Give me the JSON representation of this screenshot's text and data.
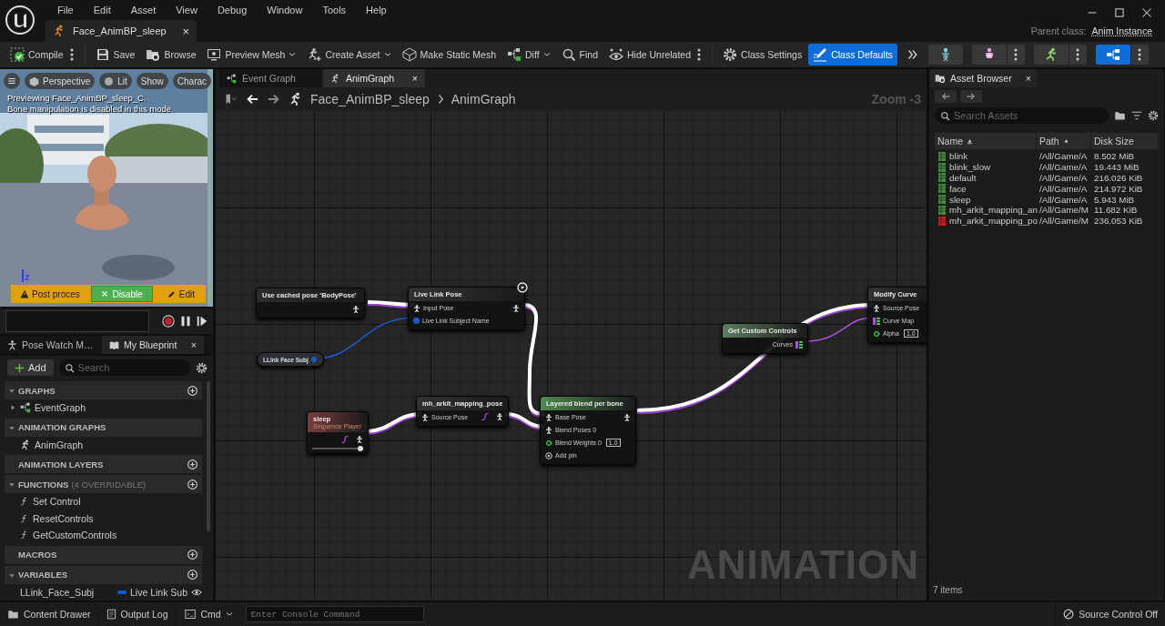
{
  "menu": [
    "File",
    "Edit",
    "Asset",
    "View",
    "Debug",
    "Window",
    "Tools",
    "Help"
  ],
  "document_tab": {
    "title": "Face_AnimBP_sleep",
    "close": "×"
  },
  "parent_class": {
    "label": "Parent class:",
    "value": "Anim Instance"
  },
  "toolbar": [
    {
      "label": "Compile",
      "more": true,
      "selected": false
    },
    {
      "label": "Save",
      "selected": false
    },
    {
      "label": "Browse",
      "selected": false
    },
    {
      "label": "Preview Mesh",
      "dropdown": true,
      "selected": false
    },
    {
      "label": "Create Asset",
      "dropdown": true,
      "selected": false
    },
    {
      "label": "Make Static Mesh",
      "selected": false
    },
    {
      "label": "Diff",
      "dropdown": true,
      "selected": false
    },
    {
      "label": "Find",
      "selected": false
    },
    {
      "label": "Hide Unrelated",
      "more": true,
      "selected": false
    },
    {
      "label": "Class Settings",
      "selected": false
    },
    {
      "label": "Class Defaults",
      "selected": true
    }
  ],
  "modes": [
    {
      "selected": false,
      "more": false
    },
    {
      "selected": false,
      "more": true
    },
    {
      "selected": false,
      "more": true
    },
    {
      "selected": true,
      "more": true
    }
  ],
  "viewport": {
    "buttons": [
      "Perspective",
      "Lit",
      "Show",
      "Charac"
    ],
    "message": [
      "Previewing Face_AnimBP_sleep_C.",
      "Bone manipulation is disabled in this mode."
    ],
    "axis": "Z",
    "notice": {
      "text": "Post proces",
      "disable": "Disable",
      "edit": "Edit"
    }
  },
  "left_tabs": [
    {
      "label": "Pose Watch M…",
      "selected": false
    },
    {
      "label": "My Blueprint",
      "selected": true,
      "close": "×"
    }
  ],
  "my_blueprint": {
    "add": "Add",
    "search": {
      "placeholder": "Search"
    },
    "sections": [
      {
        "title": "GRAPHS",
        "expanded": true,
        "add": true,
        "items": [
          {
            "kind": "graph",
            "label": "EventGraph",
            "expanded": false
          }
        ]
      },
      {
        "title": "ANIMATION GRAPHS",
        "expanded": true,
        "add": false,
        "items": [
          {
            "kind": "anim_graph",
            "label": "AnimGraph"
          }
        ]
      },
      {
        "title": "ANIMATION LAYERS",
        "add": true
      },
      {
        "title": "FUNCTIONS",
        "note": "(4 OVERRIDABLE)",
        "expanded": true,
        "add": true,
        "items": [
          {
            "kind": "function",
            "label": "Set Control"
          },
          {
            "kind": "function",
            "label": "ResetControls"
          },
          {
            "kind": "function",
            "label": "GetCustomControls"
          }
        ]
      },
      {
        "title": "MACROS",
        "add": true
      },
      {
        "title": "VARIABLES",
        "expanded": true,
        "add": true,
        "items": [
          {
            "kind": "variable",
            "label": "LLink_Face_Subj",
            "type": "Live Link Sub",
            "color": "#0a5fd8"
          }
        ]
      }
    ]
  },
  "graph_tabs": [
    {
      "label": "Event Graph",
      "selected": false
    },
    {
      "label": "AnimGraph",
      "selected": true,
      "close": "×"
    }
  ],
  "breadcrumb": [
    "Face_AnimBP_sleep",
    "AnimGraph"
  ],
  "zoom": "Zoom -3",
  "watermark": "ANIMATION",
  "nodes": [
    {
      "kind": "cached_pose",
      "title": "Use cached pose 'BodyPose'"
    },
    {
      "kind": "live_link",
      "title": "Live Link Pose",
      "pins": [
        {
          "kind": "pose",
          "label": "Input Pose"
        },
        {
          "kind": "name",
          "label": "Live Link Subject Name"
        }
      ]
    },
    {
      "kind": "variable",
      "title": "LLink Face Subj"
    },
    {
      "kind": "sequence_player",
      "title": "sleep",
      "subtitle": "Sequence Player",
      "level": 0.95
    },
    {
      "kind": "pose_asset",
      "title": "mh_arkit_mapping_pose",
      "pins": [
        {
          "kind": "pose",
          "label": "Source Pose"
        }
      ]
    },
    {
      "kind": "blend",
      "title": "Layered blend per bone",
      "pins": [
        {
          "kind": "pose",
          "label": "Base Pose"
        },
        {
          "kind": "pose",
          "label": "Blend Poses 0"
        },
        {
          "kind": "float",
          "label": "Blend Weights 0",
          "value": "1.0"
        },
        {
          "kind": "add",
          "label": "Add pin"
        }
      ]
    },
    {
      "kind": "function",
      "title": "Get Custom Controls",
      "pins": [
        {
          "kind": "map",
          "label": "Curves"
        }
      ]
    },
    {
      "kind": "modify",
      "title": "Modify Curve",
      "pins": [
        {
          "kind": "pose",
          "label": "Source Pose"
        },
        {
          "kind": "map",
          "label": "Curve Map"
        },
        {
          "kind": "float",
          "label": "Alpha",
          "value": "1.0"
        }
      ]
    }
  ],
  "asset_browser": {
    "tab": {
      "label": "Asset Browser",
      "close": "×"
    },
    "search": {
      "placeholder": "Search Assets"
    },
    "columns": [
      "Name",
      "Path",
      "Disk Size"
    ],
    "rows": [
      {
        "name": "blink",
        "path": "/All/Game/A",
        "size": "8.502 MiB",
        "color": "#3f8f3f"
      },
      {
        "name": "blink_slow",
        "path": "/All/Game/A",
        "size": "19.443 MiB",
        "color": "#3f8f3f"
      },
      {
        "name": "default",
        "path": "/All/Game/A",
        "size": "216.026 KiB",
        "color": "#3f8f3f"
      },
      {
        "name": "face",
        "path": "/All/Game/A",
        "size": "214.972 KiB",
        "color": "#3f8f3f"
      },
      {
        "name": "sleep",
        "path": "/All/Game/A",
        "size": "5.943 MiB",
        "color": "#3f8f3f"
      },
      {
        "name": "mh_arkit_mapping_an",
        "path": "/All/Game/M",
        "size": "11.682 KiB",
        "color": "#3f8f3f"
      },
      {
        "name": "mh_arkit_mapping_po",
        "path": "/All/Game/M",
        "size": "236.053 KiB",
        "color": "#d81c1c"
      }
    ],
    "count": "7 items"
  },
  "status_bar": {
    "buttons": [
      "Content Drawer",
      "Output Log"
    ],
    "cmd": "Cmd",
    "console": {
      "placeholder": "Enter Console Command"
    },
    "source_control": "Source Control Off"
  }
}
